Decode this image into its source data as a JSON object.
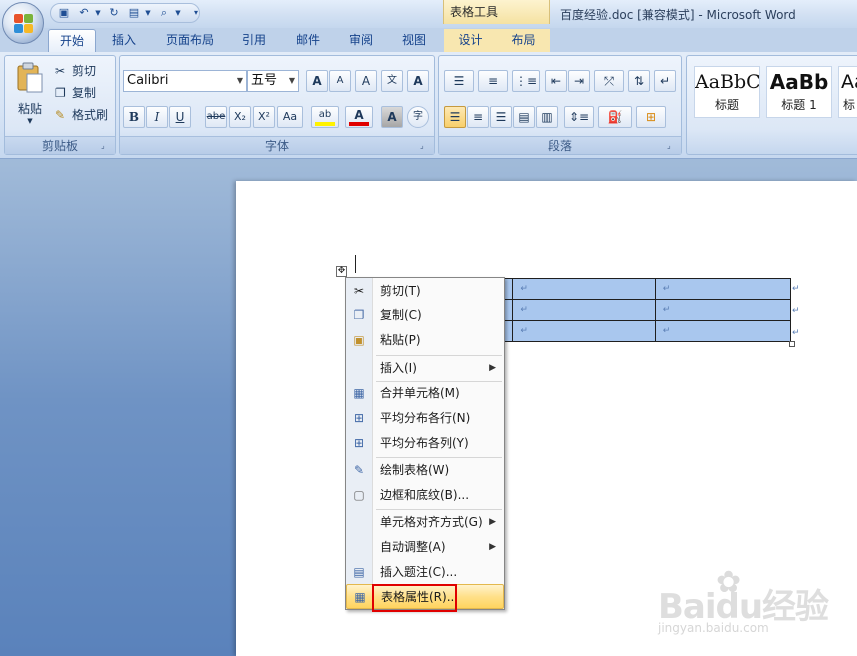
{
  "window": {
    "title": "百度经验.doc [兼容模式] - Microsoft Word",
    "context_tab_group": "表格工具"
  },
  "quick_access": {
    "icons": [
      "save-icon",
      "undo-icon",
      "redo-icon",
      "new-doc-icon",
      "print-preview-icon",
      "customize-icon"
    ]
  },
  "tabs": [
    {
      "label": "开始",
      "active": true
    },
    {
      "label": "插入"
    },
    {
      "label": "页面布局"
    },
    {
      "label": "引用"
    },
    {
      "label": "邮件"
    },
    {
      "label": "审阅"
    },
    {
      "label": "视图"
    },
    {
      "label": "设计",
      "contextual": true
    },
    {
      "label": "布局",
      "contextual": true
    }
  ],
  "ribbon": {
    "clipboard": {
      "label": "剪贴板",
      "paste": "粘贴",
      "cut": "剪切",
      "copy": "复制",
      "format_painter": "格式刷"
    },
    "font": {
      "label": "字体",
      "font_name": "Calibri",
      "font_size": "五号",
      "bold": "B",
      "italic": "I",
      "underline": "U",
      "strike": "abe",
      "subscript": "X₂",
      "superscript": "X²",
      "change_case": "Aa",
      "grow": "A",
      "shrink": "A",
      "clear": "A",
      "phonetic": "文",
      "border": "A",
      "char_shading": "A",
      "enclose": "字"
    },
    "paragraph": {
      "label": "段落"
    },
    "styles": {
      "items": [
        {
          "sample": "AaBbC",
          "name": "标题"
        },
        {
          "sample": "AaBb",
          "name": "标题 1"
        },
        {
          "sample": "Aa",
          "name": "标"
        }
      ]
    }
  },
  "document": {
    "table_marker": "↵",
    "rows": [
      [
        "↵",
        "↵",
        "↵",
        "↵"
      ],
      [
        "↵",
        "↵",
        "↵",
        "↵"
      ],
      [
        "↵",
        "↵",
        "↵",
        "↵"
      ]
    ]
  },
  "context_menu": {
    "items": [
      {
        "label": "剪切(T)",
        "icon": "scissors-icon"
      },
      {
        "label": "复制(C)",
        "icon": "copy-icon"
      },
      {
        "label": "粘贴(P)",
        "icon": "paste-icon"
      },
      {
        "label": "插入(I)",
        "submenu": true
      },
      {
        "label": "合并单元格(M)",
        "icon": "merge-cells-icon"
      },
      {
        "label": "平均分布各行(N)",
        "icon": "distribute-rows-icon"
      },
      {
        "label": "平均分布各列(Y)",
        "icon": "distribute-columns-icon"
      },
      {
        "label": "绘制表格(W)",
        "icon": "draw-table-icon"
      },
      {
        "label": "边框和底纹(B)...",
        "icon": "borders-icon"
      },
      {
        "label": "单元格对齐方式(G)",
        "submenu": true
      },
      {
        "label": "自动调整(A)",
        "submenu": true
      },
      {
        "label": "插入题注(C)...",
        "icon": "caption-icon"
      },
      {
        "label": "表格属性(R)...",
        "icon": "table-properties-icon",
        "highlighted": true
      }
    ]
  },
  "watermark": {
    "text": "Baidu经验",
    "sub": "jingyan.baidu.com"
  },
  "colors": {
    "highlight_box": "#e00000",
    "table_fill": "#a9c7ee",
    "ribbon_text": "#1e395b"
  }
}
